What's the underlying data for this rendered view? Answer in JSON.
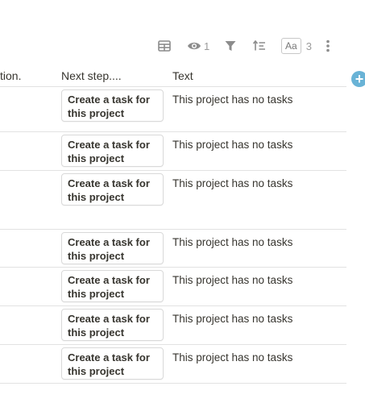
{
  "toolbar": {
    "views_count": "1",
    "font_label": "Aa",
    "font_count": "3"
  },
  "columns": {
    "col1": "tion.",
    "col2": "Next step....",
    "col3": "Text"
  },
  "rows": [
    {
      "button": "Create a task for this project",
      "text": "This project has no tasks"
    },
    {
      "button": "Create a task for this project",
      "text": "This project has no tasks"
    },
    {
      "button": "Create a task for this project",
      "text": "This project has no tasks"
    },
    {
      "button": "Create a task for this project",
      "text": "This project has no tasks"
    },
    {
      "button": "Create a task for this project",
      "text": "This project has no tasks"
    },
    {
      "button": "Create a task for this project",
      "text": "This project has no tasks"
    },
    {
      "button": "Create a task for this project",
      "text": "This project has no tasks"
    }
  ],
  "add_column_symbol": "+",
  "colors": {
    "accent": "#69b3d6",
    "border": "#e2e2e2",
    "text": "#37352f",
    "icon": "#8c8c8c"
  }
}
